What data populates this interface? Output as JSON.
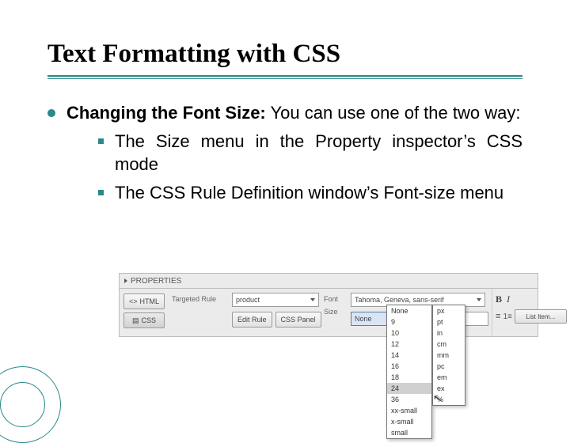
{
  "title": "Text Formatting with CSS",
  "bullet": {
    "lead": "Changing the Font Size:",
    "rest": " You can use one of the two way:",
    "subs": [
      "The Size menu in the Property inspector’s CSS mode",
      "The CSS Rule Definition window’s Font-size menu"
    ]
  },
  "panel": {
    "header": "PROPERTIES",
    "left": {
      "html": "HTML",
      "css": "CSS"
    },
    "mid": {
      "targetedRuleLabel": "Targeted Rule",
      "targetedRuleValue": "product",
      "editRule": "Edit Rule",
      "cssPanel": "CSS Panel",
      "fontLabel": "Font",
      "fontValue": "Tahoma, Geneva, sans-serif",
      "sizeLabel": "Size",
      "sizeValue": "None",
      "unitValue": "px"
    },
    "right": {
      "listItem": "List Item..."
    }
  },
  "sizeOptions": [
    "None",
    "9",
    "10",
    "12",
    "14",
    "16",
    "18",
    "24",
    "36",
    "xx-small",
    "x-small",
    "small"
  ],
  "sizeSelected": "24",
  "unitOptions": [
    "px",
    "pt",
    "in",
    "cm",
    "mm",
    "pc",
    "em",
    "ex",
    "%"
  ]
}
